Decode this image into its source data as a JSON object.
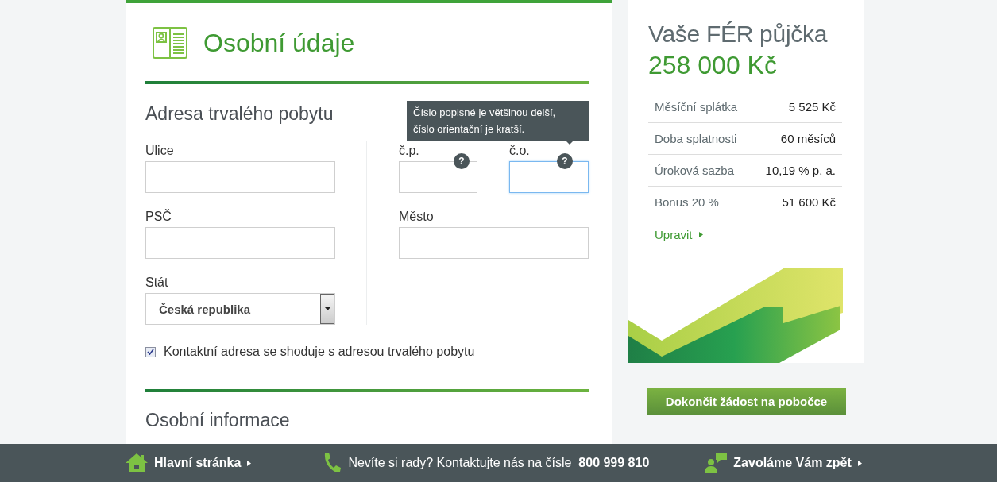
{
  "form": {
    "title": "Osobní údaje",
    "address_section": {
      "heading": "Adresa trvalého pobytu",
      "fields": [
        {
          "kind": "text",
          "label": "Ulice"
        },
        {
          "kind": "pair",
          "items": [
            {
              "label": "č.p.",
              "focused": false,
              "help": "?"
            },
            {
              "label": "č.o.",
              "focused": true,
              "help": "?"
            }
          ]
        },
        {
          "kind": "text",
          "label": "PSČ"
        },
        {
          "kind": "text",
          "label": "Město"
        },
        {
          "kind": "select",
          "label": "Stát",
          "value": "Česká republika"
        }
      ],
      "tooltip": "Číslo popisné je většinou delší,\nčíslo orientační je kratší.",
      "checkbox": {
        "label": "Kontaktní adresa se shoduje s adresou trvalého pobytu",
        "checked": true
      }
    },
    "next_section": {
      "heading": "Osobní informace"
    }
  },
  "loan": {
    "title": "Vaše FÉR půjčka",
    "amount": "258 000 Kč",
    "rows": [
      {
        "label": "Měsíční splátka",
        "value": "5 525 Kč"
      },
      {
        "label": "Doba splatnosti",
        "value": "60 měsíců"
      },
      {
        "label": "Úroková sazba",
        "value": "10,19 % p. a."
      },
      {
        "label": "Bonus 20 %",
        "value": "51 600 Kč"
      }
    ],
    "edit_link": "Upravit"
  },
  "finish_button": "Dokončit žádost na pobočce",
  "footer": [
    {
      "kind": "home",
      "text": "Hlavní stránka"
    },
    {
      "kind": "phone",
      "text": "Nevíte si rady? Kontaktujte nás na čísle  **800 999 810**"
    },
    {
      "kind": "callback",
      "text": "Zavoláme Vám zpět"
    }
  ]
}
